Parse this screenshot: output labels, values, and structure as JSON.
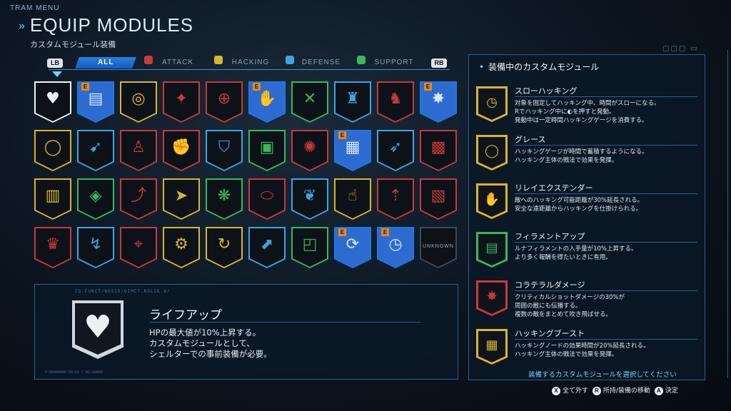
{
  "header": {
    "menu": "TRAM MENU",
    "title": "EQUIP MODULES",
    "subtitle": "カスタムモジュール装備"
  },
  "tabs": {
    "lb": "LB",
    "rb": "RB",
    "items": [
      {
        "label": "ALL",
        "color": "#2a7fe0"
      },
      {
        "label": "ATTACK",
        "color": "#c83a3a"
      },
      {
        "label": "HACKING",
        "color": "#d9b530"
      },
      {
        "label": "DEFENSE",
        "color": "#3aa6e0"
      },
      {
        "label": "SUPPORT",
        "color": "#3ab85a"
      }
    ]
  },
  "grid": {
    "rows": [
      [
        {
          "icon": "heart-plus",
          "cat": "selected",
          "equipped": false
        },
        {
          "icon": "filament-canister",
          "cat": "support",
          "equipped": true
        },
        {
          "icon": "hacking-target",
          "cat": "hacking",
          "equipped": false
        },
        {
          "icon": "soldier-hit",
          "cat": "attack",
          "equipped": false
        },
        {
          "icon": "crosshair",
          "cat": "attack",
          "equipped": false
        },
        {
          "icon": "hand-wave",
          "cat": "hacking",
          "equipped": true
        },
        {
          "icon": "crossed-arrows",
          "cat": "support",
          "equipped": false
        },
        {
          "icon": "defense-crouch",
          "cat": "defense",
          "equipped": false
        },
        {
          "icon": "runner",
          "cat": "attack",
          "equipped": false
        },
        {
          "icon": "collateral",
          "cat": "attack",
          "equipped": true
        }
      ],
      [
        {
          "icon": "grace-ring",
          "cat": "hacking",
          "equipped": false
        },
        {
          "icon": "gunner",
          "cat": "defense",
          "equipped": false
        },
        {
          "icon": "puppet",
          "cat": "attack",
          "equipped": false
        },
        {
          "icon": "brawler",
          "cat": "attack",
          "equipped": false
        },
        {
          "icon": "crouch-shield",
          "cat": "defense",
          "equipped": false
        },
        {
          "icon": "chip",
          "cat": "support",
          "equipped": false
        },
        {
          "icon": "blast",
          "cat": "attack",
          "equipped": false
        },
        {
          "icon": "grid-boost",
          "cat": "hacking",
          "equipped": true
        },
        {
          "icon": "kick",
          "cat": "defense",
          "equipped": false
        },
        {
          "icon": "grid-blast",
          "cat": "attack",
          "equipped": false
        }
      ],
      [
        {
          "icon": "grid-hand",
          "cat": "hacking",
          "equipped": false
        },
        {
          "icon": "chip-grab",
          "cat": "support",
          "equipped": false
        },
        {
          "icon": "leap",
          "cat": "attack",
          "equipped": false
        },
        {
          "icon": "dash",
          "cat": "hacking",
          "equipped": false
        },
        {
          "icon": "drone",
          "cat": "support",
          "equipped": false
        },
        {
          "icon": "ammo",
          "cat": "attack",
          "equipped": false
        },
        {
          "icon": "flex",
          "cat": "defense",
          "equipped": false
        },
        {
          "icon": "hand-plus",
          "cat": "hacking",
          "equipped": false
        },
        {
          "icon": "runner-up",
          "cat": "attack",
          "equipped": false
        },
        {
          "icon": "grid-punch",
          "cat": "attack",
          "equipped": false
        }
      ],
      [
        {
          "icon": "muscle",
          "cat": "attack",
          "equipped": false
        },
        {
          "icon": "slide",
          "cat": "defense",
          "equipped": false
        },
        {
          "icon": "target-man",
          "cat": "attack",
          "equipped": false
        },
        {
          "icon": "tech-ring",
          "cat": "hacking",
          "equipped": false
        },
        {
          "icon": "rotate-shield",
          "cat": "hacking",
          "equipped": false
        },
        {
          "icon": "shield-arrow",
          "cat": "defense",
          "equipped": false
        },
        {
          "icon": "chips",
          "cat": "support",
          "equipped": false
        },
        {
          "icon": "loop",
          "cat": "hacking",
          "equipped": true
        },
        {
          "icon": "slow-clock",
          "cat": "hacking",
          "equipped": true
        },
        {
          "icon": "unknown",
          "cat": "unknown",
          "equipped": false,
          "label": "UNKNOWN"
        }
      ]
    ]
  },
  "detail": {
    "tiny_top": "ID:FUNCT/NOSIS/DIMCT.NOLIK.A/",
    "name": "ライフアップ",
    "desc_lines": [
      "HPの最大値が10%上昇する。",
      "カスタムモジュールとして、",
      "シェルターでの事前装備が必要。"
    ],
    "tiny_foot": "P:00000000:50:11 / 00.00000"
  },
  "equipped_panel": {
    "title": "装備中のカスタムモジュール",
    "entries": [
      {
        "name": "スローハッキング",
        "icon": "slow-clock",
        "color": "#d9b530",
        "desc": "対象を固定してハッキング中、時間がスローになる。\nRでハッキング中に◐を押すと発動。\n発動中は一定時間ハッキングゲージを消費する。"
      },
      {
        "name": "グレース",
        "icon": "grace-ring",
        "color": "#d9b530",
        "desc": "ハッキングゲージが時間で蓄積するようになる。\nハッキング主体の戦法で効果を発揮。"
      },
      {
        "name": "リレイエクステンダー",
        "icon": "hand-wave",
        "color": "#d9b530",
        "desc": "敵へのハッキング可能距離が30%延長される。\n安全な遠距離からハッキングを仕掛けられる。"
      },
      {
        "name": "フィラメントアップ",
        "icon": "filament-canister",
        "color": "#3ab85a",
        "desc": "ルナフィラメントの入手量が10%上昇する。\nより多く報酬を得たいときに有用。"
      },
      {
        "name": "コラテラルダメージ",
        "icon": "collateral",
        "color": "#c83a3a",
        "desc": "クリティカルショットダメージの30%が\n周囲の敵にも伝播する。\n複数の敵をまとめて吹き飛ばせる。"
      },
      {
        "name": "ハッキングブースト",
        "icon": "grid-boost",
        "color": "#d9b530",
        "desc": "ハッキングノードの効果時間が20%延長される。\nハッキング主体の戦法で効果を発揮。"
      }
    ],
    "prompt": "装備するカスタムモジュールを選択してください"
  },
  "footer": {
    "x_btn": "X",
    "x_label": "全て外す",
    "r_btn": "R",
    "r_label": "所持/装備の移動",
    "a_btn": "A",
    "a_label": "決定"
  },
  "colors": {
    "attack": "#c83a3a",
    "hacking": "#d9b530",
    "defense": "#3aa6e0",
    "support": "#3ab85a",
    "equipped": "#1c79e6",
    "accent": "#6fd2ff"
  }
}
